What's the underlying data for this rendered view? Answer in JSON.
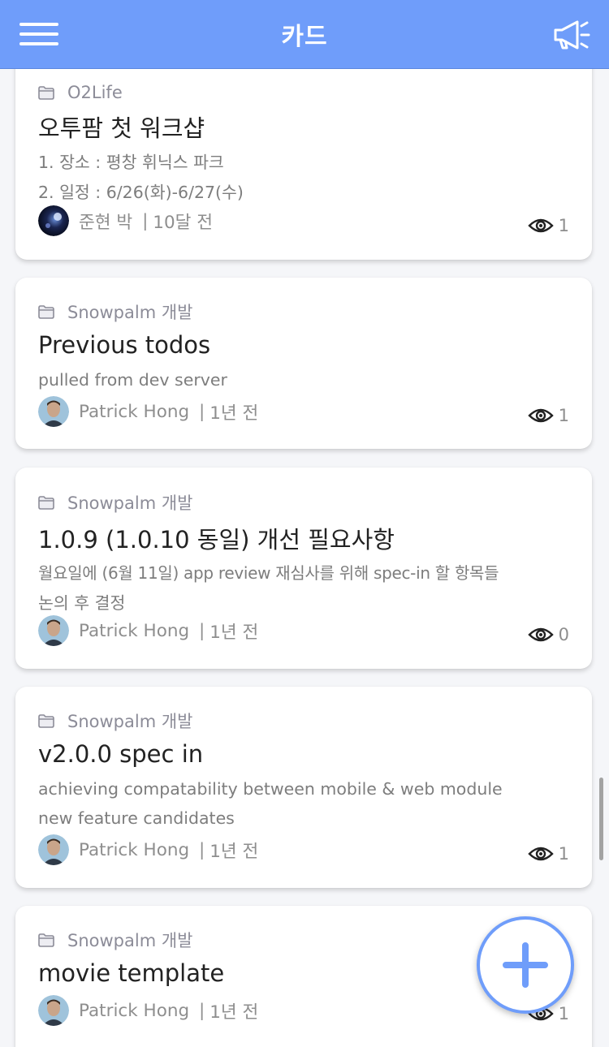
{
  "header": {
    "title": "카드",
    "menu_icon": "hamburger-icon",
    "announce_icon": "megaphone-icon",
    "color": "#6f9dfa"
  },
  "cards": [
    {
      "folder": "O2Life",
      "title": "오투팜 첫 워크샵",
      "desc_lines": [
        "1. 장소 : 평창 휘닉스 파크",
        "2. 일정 : 6/26(화)-6/27(수)"
      ],
      "author": "준현 박",
      "time": "10달 전",
      "views": "1"
    },
    {
      "folder": "Snowpalm 개발",
      "title": "Previous todos",
      "desc_lines": [
        "pulled from dev server"
      ],
      "author": "Patrick Hong",
      "time": "1년 전",
      "views": "1"
    },
    {
      "folder": "Snowpalm 개발",
      "title": "1.0.9 (1.0.10 동일) 개선 필요사항",
      "desc_lines": [
        "월요일에 (6월 11일) app review 재심사를 위해 spec-in 할 항목들",
        "논의 후 결정"
      ],
      "author": "Patrick Hong",
      "time": "1년 전",
      "views": "0"
    },
    {
      "folder": "Snowpalm 개발",
      "title": "v2.0.0 spec in",
      "desc_lines": [
        "achieving compatability between mobile & web module",
        "new feature candidates"
      ],
      "author": "Patrick Hong",
      "time": "1년 전",
      "views": "1"
    },
    {
      "folder": "Snowpalm 개발",
      "title": "movie template",
      "desc_lines": [],
      "author": "Patrick Hong",
      "time": "1년 전",
      "views": "1"
    }
  ],
  "fab": {
    "icon": "plus-icon"
  }
}
